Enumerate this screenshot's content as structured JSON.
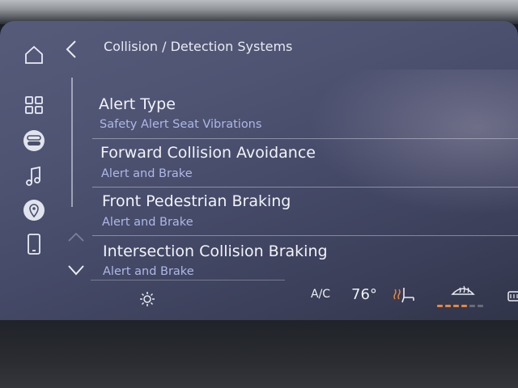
{
  "header": {
    "title": "Collision / Detection Systems"
  },
  "sidebar": {
    "items": [
      {
        "name": "home-icon"
      },
      {
        "name": "apps-grid-icon"
      },
      {
        "name": "toggle-icon"
      },
      {
        "name": "music-note-icon"
      },
      {
        "name": "location-pin-icon"
      },
      {
        "name": "phone-icon"
      }
    ]
  },
  "list": {
    "items": [
      {
        "title": "Alert Type",
        "value": "Safety Alert Seat Vibrations"
      },
      {
        "title": "Forward Collision Avoidance",
        "value": "Alert and Brake"
      },
      {
        "title": "Front Pedestrian Braking",
        "value": "Alert and Brake"
      },
      {
        "title": "Intersection Collision Braking",
        "value": "Alert and Brake"
      }
    ]
  },
  "climate": {
    "ac_label": "A/C",
    "temperature": "76°",
    "fan_level": 4,
    "fan_max": 6,
    "colors": {
      "active": "#e8873a",
      "inactive": "#6a6d78"
    }
  }
}
